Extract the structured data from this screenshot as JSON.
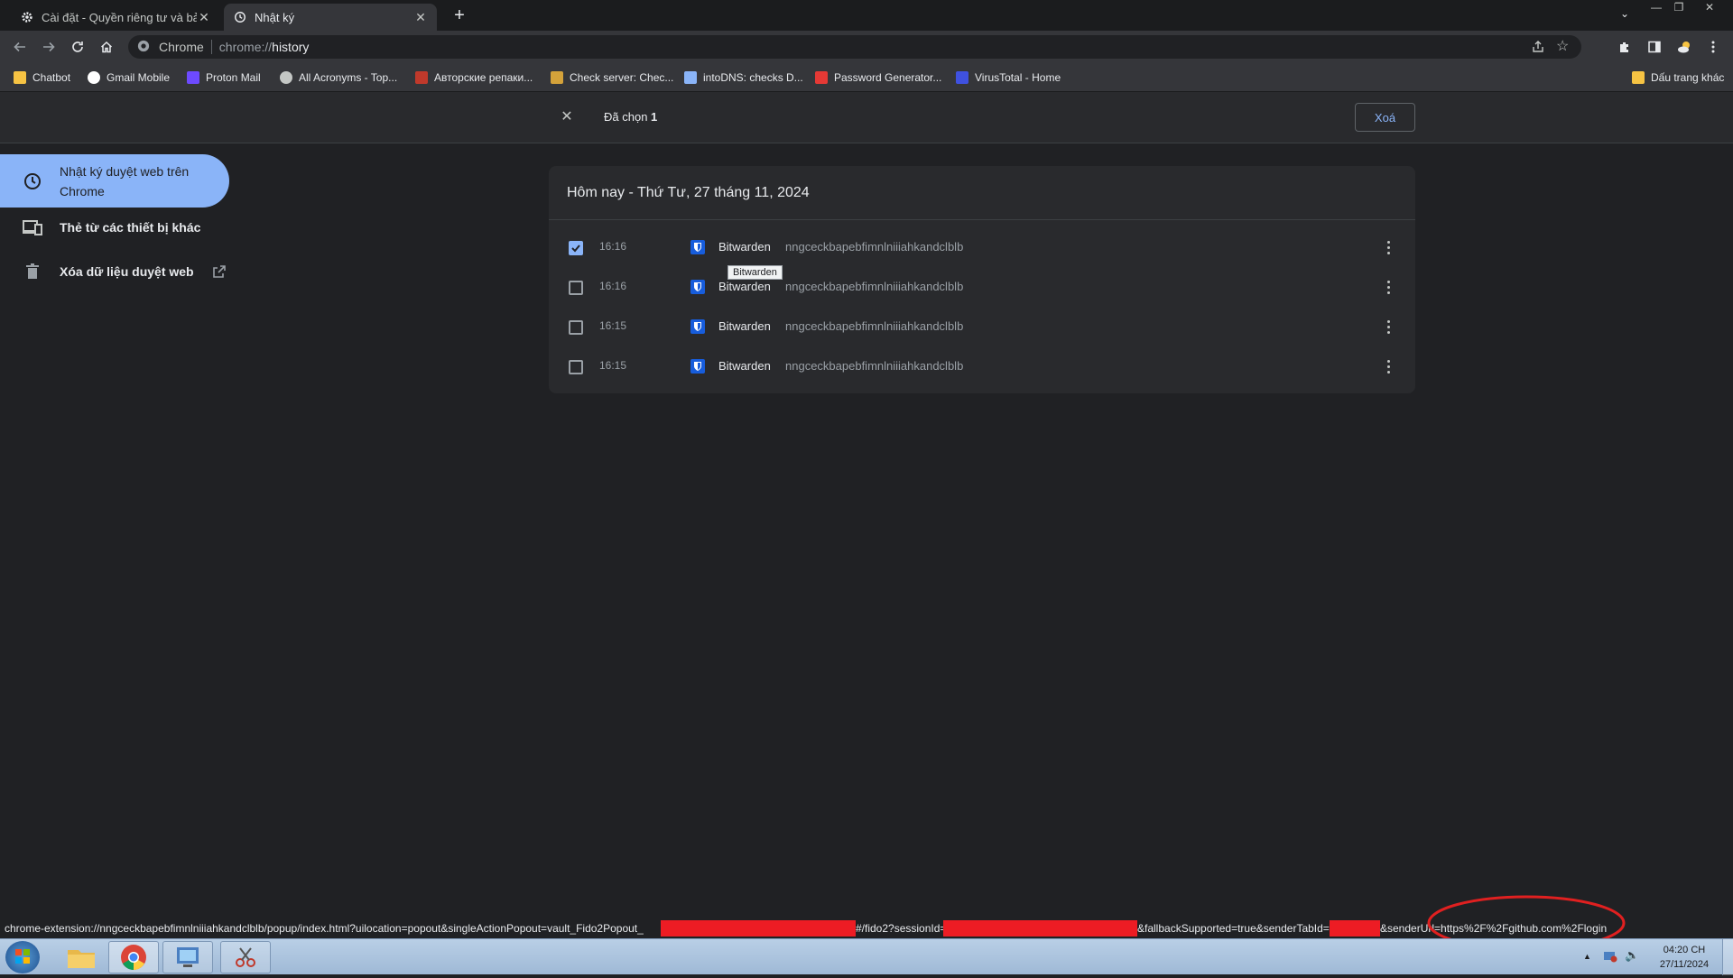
{
  "tabs": [
    {
      "title": "Cài đặt - Quyền riêng tư và bảo mật",
      "icon": "gear-icon"
    },
    {
      "title": "Nhật ký",
      "icon": "history-icon"
    }
  ],
  "omnibox": {
    "site_label": "Chrome",
    "url_prefix": "chrome://",
    "url_path": "history"
  },
  "bookmarks": [
    {
      "label": "Chatbot",
      "icon": "folder-icon",
      "color": "#f6c343"
    },
    {
      "label": "Gmail Mobile",
      "icon": "google-icon",
      "color": "#ffffff"
    },
    {
      "label": "Proton Mail",
      "icon": "proton-icon",
      "color": "#6d4aff"
    },
    {
      "label": "All Acronyms - Top...",
      "icon": "acronyms-icon",
      "color": "#c4c7c5"
    },
    {
      "label": "Авторские репаки...",
      "icon": "repack-icon",
      "color": "#c0392b"
    },
    {
      "label": "Check server: Chec...",
      "icon": "check-icon",
      "color": "#d4a23a"
    },
    {
      "label": "intoDNS: checks D...",
      "icon": "dns-icon",
      "color": "#8ab4f8"
    },
    {
      "label": "Password Generator...",
      "icon": "password-icon",
      "color": "#e53935"
    },
    {
      "label": "VirusTotal - Home",
      "icon": "virustotal-icon",
      "color": "#3f51e0"
    }
  ],
  "other_bookmarks": "Dấu trang khác",
  "selection": {
    "label": "Đã chọn",
    "count": "1",
    "delete_label": "Xoá"
  },
  "sidebar": {
    "history_line1": "Nhật ký duyệt web trên",
    "history_line2": "Chrome",
    "tabs_other": "Thẻ từ các thiết bị khác",
    "clear": "Xóa dữ liệu duyệt web"
  },
  "card": {
    "heading": "Hôm nay - Thứ Tư, 27 tháng 11, 2024",
    "rows": [
      {
        "time": "16:16",
        "title": "Bitwarden",
        "domain": "nngceckbapebfimnlniiiahkandclblb",
        "checked": true
      },
      {
        "time": "16:16",
        "title": "Bitwarden",
        "domain": "nngceckbapebfimnlniiiahkandclblb",
        "checked": false
      },
      {
        "time": "16:15",
        "title": "Bitwarden",
        "domain": "nngceckbapebfimnlniiiahkandclblb",
        "checked": false
      },
      {
        "time": "16:15",
        "title": "Bitwarden",
        "domain": "nngceckbapebfimnlniiiahkandclblb",
        "checked": false
      }
    ],
    "tooltip": "Bitwarden"
  },
  "status": {
    "part1": "chrome-extension://nngceckbapebfimnlniiiahkandclblb/popup/index.html?uilocation=popout&singleActionPopout=vault_Fido2Popout_",
    "part2": "#/fido2?sessionId=",
    "part3": "&fallbackSupported=true&senderTabId=",
    "part4": "&senderUrl=https%2F%2Fgithub.com%2Flogin",
    "redact_color": "#ed1c24",
    "annotation_color": "#e02020"
  },
  "taskbar": {
    "time": "04:20 CH",
    "date": "27/11/2024"
  }
}
